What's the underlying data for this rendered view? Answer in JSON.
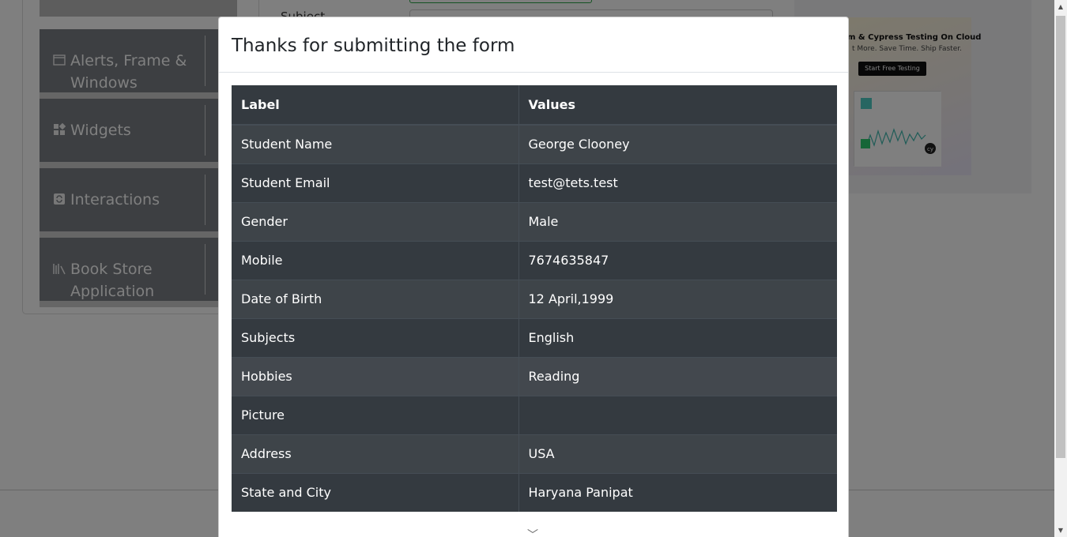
{
  "sidebar": {
    "groups": [
      {
        "label": "Alerts, Frame & Windows",
        "icon": "window-icon"
      },
      {
        "label": "Widgets",
        "icon": "widgets-icon"
      },
      {
        "label": "Interactions",
        "icon": "interactions-icon"
      },
      {
        "label": "Book Store Application",
        "icon": "book-icon"
      }
    ]
  },
  "form": {
    "subject_label": "Subject"
  },
  "ad": {
    "title": "m & Cypress Testing On Cloud",
    "subtitle": "t More. Save Time. Ship Faster.",
    "button": "Start Free Testing",
    "badge": "cy"
  },
  "modal": {
    "title": "Thanks for submitting the form",
    "headers": {
      "label": "Label",
      "values": "Values"
    },
    "rows": [
      {
        "label": "Student Name",
        "value": "George Clooney"
      },
      {
        "label": "Student Email",
        "value": "test@tets.test"
      },
      {
        "label": "Gender",
        "value": "Male"
      },
      {
        "label": "Mobile",
        "value": "7674635847"
      },
      {
        "label": "Date of Birth",
        "value": "12 April,1999"
      },
      {
        "label": "Subjects",
        "value": "English"
      },
      {
        "label": "Hobbies",
        "value": "Reading"
      },
      {
        "label": "Picture",
        "value": ""
      },
      {
        "label": "Address",
        "value": "USA"
      },
      {
        "label": "State and City",
        "value": "Haryana Panipat"
      }
    ],
    "scroll_hint": "﹀"
  },
  "scrollbar": {
    "up": "▲",
    "down": "▼"
  }
}
